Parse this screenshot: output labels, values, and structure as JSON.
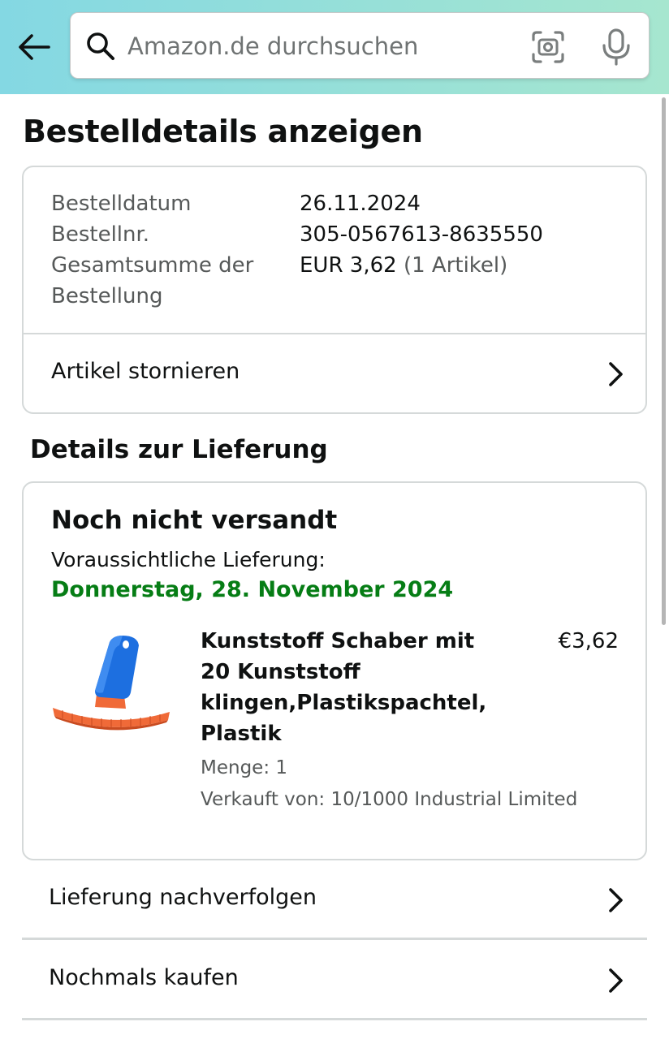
{
  "header": {
    "search": {
      "placeholder": "Amazon.de durchsuchen",
      "value": ""
    },
    "icons": [
      "back-arrow-icon",
      "search-icon",
      "camera-scan-icon",
      "microphone-icon"
    ],
    "gradient_colors": [
      "#84d8e3",
      "#a6e6cf"
    ]
  },
  "page_title": "Bestelldetails anzeigen",
  "order_summary": {
    "date_label": "Bestelldatum",
    "date_value": "26.11.2024",
    "number_label": "Bestellnr.",
    "number_value": "305-0567613-8635550",
    "total_label_line1": "Gesamtsumme der",
    "total_label_line2": "Bestellung",
    "total_value": "EUR 3,62",
    "total_items": "(1 Artikel)",
    "cancel_label": "Artikel stornieren"
  },
  "delivery": {
    "section_title": "Details zur Lieferung",
    "status": "Noch nicht versandt",
    "estimate_label": "Voraussichtliche Lieferung:",
    "estimate_date": "Donnerstag, 28. November 2024",
    "estimate_color": "#067d15",
    "item": {
      "title_lines": [
        "Kunststoff Schaber mit",
        "20 Kunststoff",
        "klingen,Plastikspachtel,",
        "Plastik"
      ],
      "price": "€3,62",
      "quantity": "Menge: 1",
      "seller": "Verkauft von: 10/1000 Industrial Limited",
      "image": "blue-plastic-scraper-with-orange-blades"
    }
  },
  "actions": {
    "track": "Lieferung nachverfolgen",
    "buy_again": "Nochmals kaufen"
  }
}
